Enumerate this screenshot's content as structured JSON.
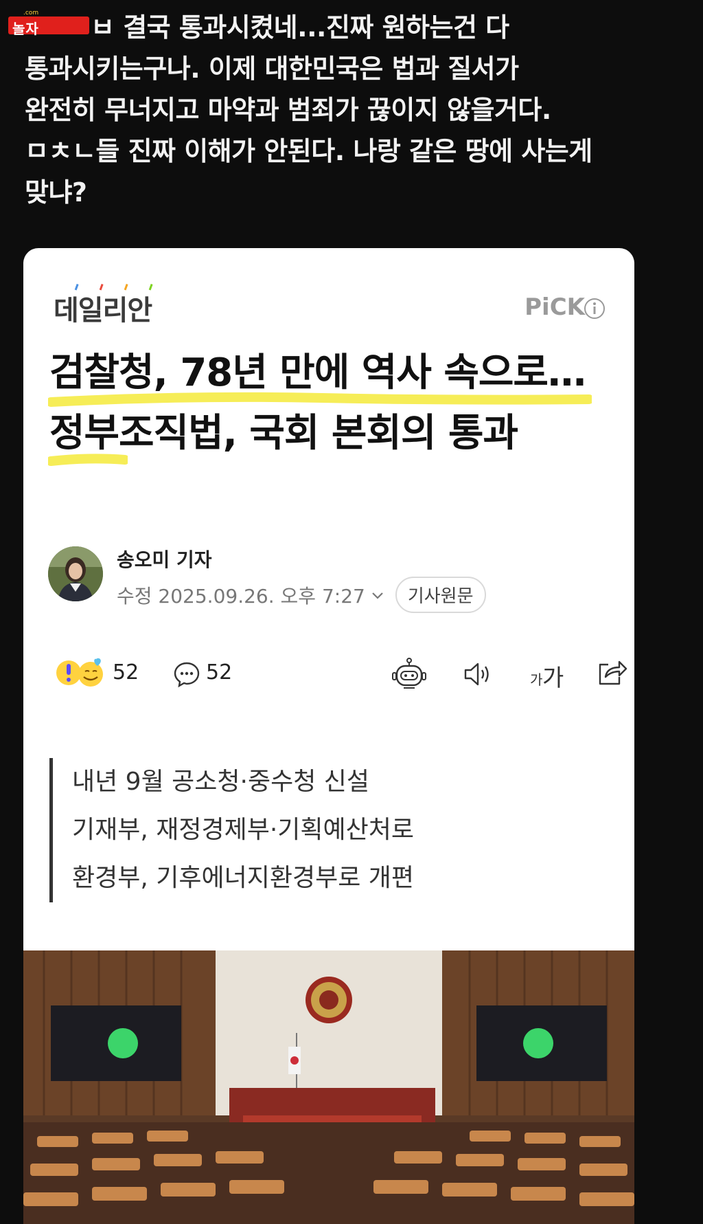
{
  "watermark": {
    "text": "놀자",
    "sub": ".com"
  },
  "post": {
    "lines": [
      "ㅂ 결국 통과시켰네...진짜 원하는건 다",
      "통과시키는구나. 이제 대한민국은 법과 질서가",
      "완전히 무너지고 마약과 범죄가 끊이지 않을거다.",
      "ㅁㅊㄴ들 진짜 이해가 안된다. 나랑 같은 땅에 사는게",
      "맞냐?"
    ]
  },
  "article": {
    "publisher": "데일리안",
    "pick_label": "PiCK",
    "headline": "검찰청, 78년 만에 역사 속으로…정부조직법, 국회 본회의 통과",
    "reporter": "송오미 기자",
    "date": "수정 2025.09.26. 오후 7:27",
    "original_button": "기사원문",
    "reaction_count": "52",
    "comment_count": "52",
    "font_size_label_small": "가",
    "font_size_label_large": "가",
    "summary": [
      "내년 9월 공소청·중수청 신설",
      "기재부, 재정경제부·기획예산처로",
      "환경부, 기후에너지환경부로 개편"
    ]
  },
  "colors": {
    "highlight": "#f4ea3a",
    "watermark_red": "#e0201c",
    "background": "#0d0d0d"
  },
  "icons": [
    "info-icon",
    "chevron-down-icon",
    "surprise-emoji-icon",
    "smile-emoji-icon",
    "comment-icon",
    "robot-icon",
    "speaker-icon",
    "share-icon"
  ]
}
